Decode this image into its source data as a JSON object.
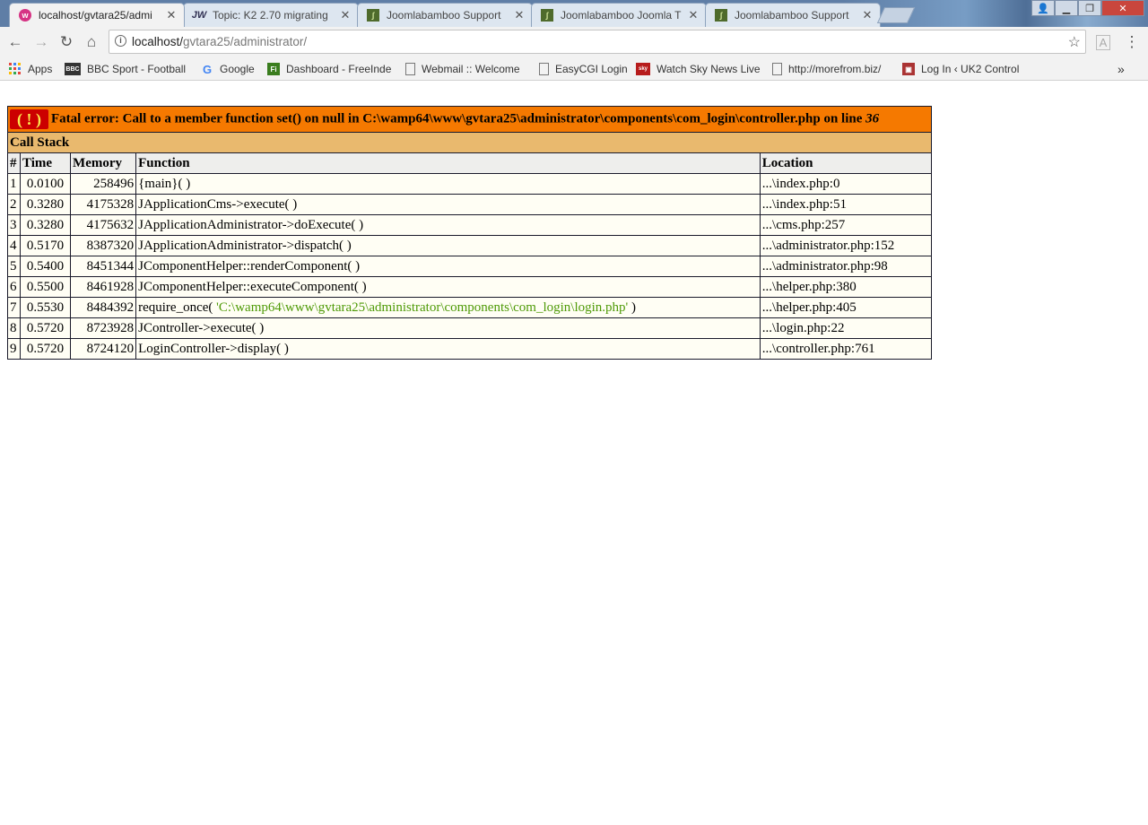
{
  "tabs": [
    {
      "title": "localhost/gvtara25/admi",
      "active": true
    },
    {
      "title": "Topic: K2 2.70 migrating",
      "active": false
    },
    {
      "title": "Joomlabamboo Support",
      "active": false
    },
    {
      "title": "Joomlabamboo Joomla T",
      "active": false
    },
    {
      "title": "Joomlabamboo Support",
      "active": false
    }
  ],
  "address": {
    "host": "localhost/",
    "path": "gvtara25/administrator/"
  },
  "bookmarks": [
    {
      "label": "Apps",
      "icon": "apps-grid-icon"
    },
    {
      "label": "BBC Sport - Football",
      "icon": "bbc-icon"
    },
    {
      "label": "Google",
      "icon": "google-icon"
    },
    {
      "label": "Dashboard - FreeInde",
      "icon": "freeindex-icon"
    },
    {
      "label": "Webmail :: Welcome",
      "icon": "page-icon"
    },
    {
      "label": "EasyCGI Login",
      "icon": "page-icon"
    },
    {
      "label": "Watch Sky News Live",
      "icon": "sky-news-icon"
    },
    {
      "label": "http://morefrom.biz/",
      "icon": "page-icon"
    },
    {
      "label": "Log In ‹ UK2 Control",
      "icon": "uk2-icon"
    }
  ],
  "error": {
    "bang": "( ! )",
    "message": "Fatal error: Call to a member function set() on null in C:\\wamp64\\www\\gvtara25\\administrator\\components\\com_login\\controller.php on line ",
    "line": "36"
  },
  "callstack": {
    "title": "Call Stack",
    "headers": {
      "num": "#",
      "time": "Time",
      "memory": "Memory",
      "function": "Function",
      "location": "Location"
    },
    "rows": [
      {
        "n": "1",
        "time": "0.0100",
        "mem": "258496",
        "fn": "{main}( )",
        "arg": "",
        "fn_end": "",
        "loc": "...\\index.php:0"
      },
      {
        "n": "2",
        "time": "0.3280",
        "mem": "4175328",
        "fn": "JApplicationCms->execute( )",
        "arg": "",
        "fn_end": "",
        "loc": "...\\index.php:51"
      },
      {
        "n": "3",
        "time": "0.3280",
        "mem": "4175632",
        "fn": "JApplicationAdministrator->doExecute( )",
        "arg": "",
        "fn_end": "",
        "loc": "...\\cms.php:257"
      },
      {
        "n": "4",
        "time": "0.5170",
        "mem": "8387320",
        "fn": "JApplicationAdministrator->dispatch( )",
        "arg": "",
        "fn_end": "",
        "loc": "...\\administrator.php:152"
      },
      {
        "n": "5",
        "time": "0.5400",
        "mem": "8451344",
        "fn": "JComponentHelper::renderComponent( )",
        "arg": "",
        "fn_end": "",
        "loc": "...\\administrator.php:98"
      },
      {
        "n": "6",
        "time": "0.5500",
        "mem": "8461928",
        "fn": "JComponentHelper::executeComponent( )",
        "arg": "",
        "fn_end": "",
        "loc": "...\\helper.php:380"
      },
      {
        "n": "7",
        "time": "0.5530",
        "mem": "8484392",
        "fn": "require_once( ",
        "arg": "'C:\\wamp64\\www\\gvtara25\\administrator\\components\\com_login\\login.php'",
        "fn_end": " )",
        "loc": "...\\helper.php:405"
      },
      {
        "n": "8",
        "time": "0.5720",
        "mem": "8723928",
        "fn": "JController->execute( )",
        "arg": "",
        "fn_end": "",
        "loc": "...\\login.php:22"
      },
      {
        "n": "9",
        "time": "0.5720",
        "mem": "8724120",
        "fn": "LoginController->display( )",
        "arg": "",
        "fn_end": "",
        "loc": "...\\controller.php:761"
      }
    ]
  },
  "colors": {
    "error_bg": "#f57900",
    "stack_bg": "#e9b96e",
    "header_bg": "#eeeeec",
    "row_bg": "#fffef4",
    "string_arg": "#4e9a06"
  }
}
